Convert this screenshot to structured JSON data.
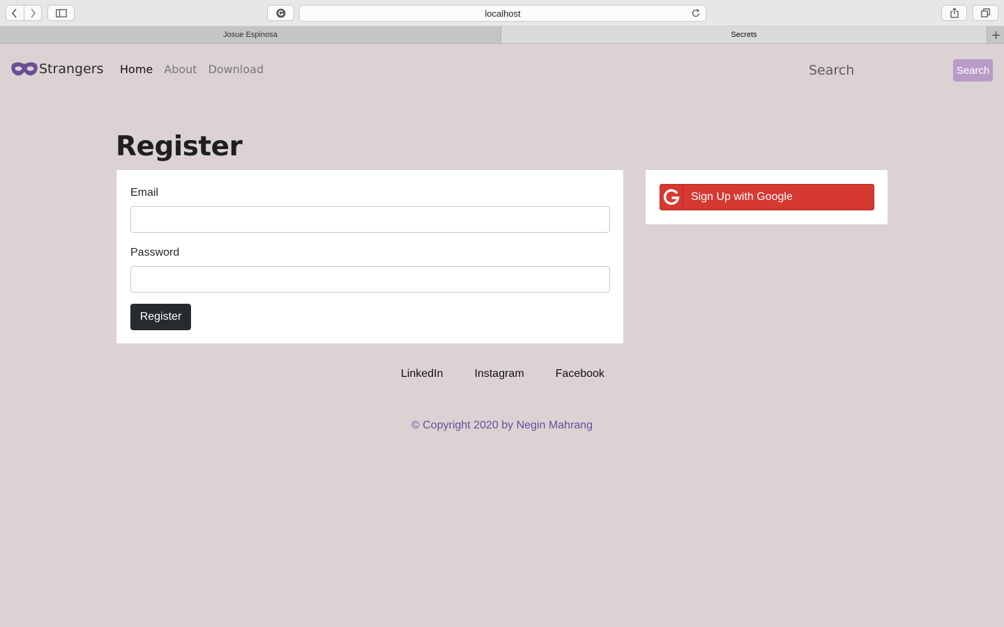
{
  "browser": {
    "address": "localhost",
    "tabs": [
      {
        "label": "Josue Espinosa",
        "active": false
      },
      {
        "label": "Secrets",
        "active": true
      }
    ]
  },
  "navbar": {
    "brand": "Strangers",
    "links": [
      "Home",
      "About",
      "Download"
    ],
    "active_link": "Home",
    "search_placeholder": "Search",
    "search_button": "Search",
    "search_button_color": "#b99bc8"
  },
  "main": {
    "title": "Register",
    "form": {
      "email_label": "Email",
      "email_value": "",
      "password_label": "Password",
      "password_value": "",
      "submit_label": "Register"
    },
    "social": {
      "google_label": "Sign Up with Google",
      "google_color": "#d63832"
    }
  },
  "footer": {
    "links": [
      "LinkedIn",
      "Instagram",
      "Facebook"
    ],
    "copyright": "© Copyright 2020 by Negin Mahrang"
  },
  "icons": [
    "chevron-left-icon",
    "chevron-right-icon",
    "sidebar-icon",
    "grammarly-icon",
    "reload-icon",
    "share-icon",
    "tabs-overview-icon",
    "plus-icon",
    "mask-logo-icon",
    "google-g-icon"
  ]
}
